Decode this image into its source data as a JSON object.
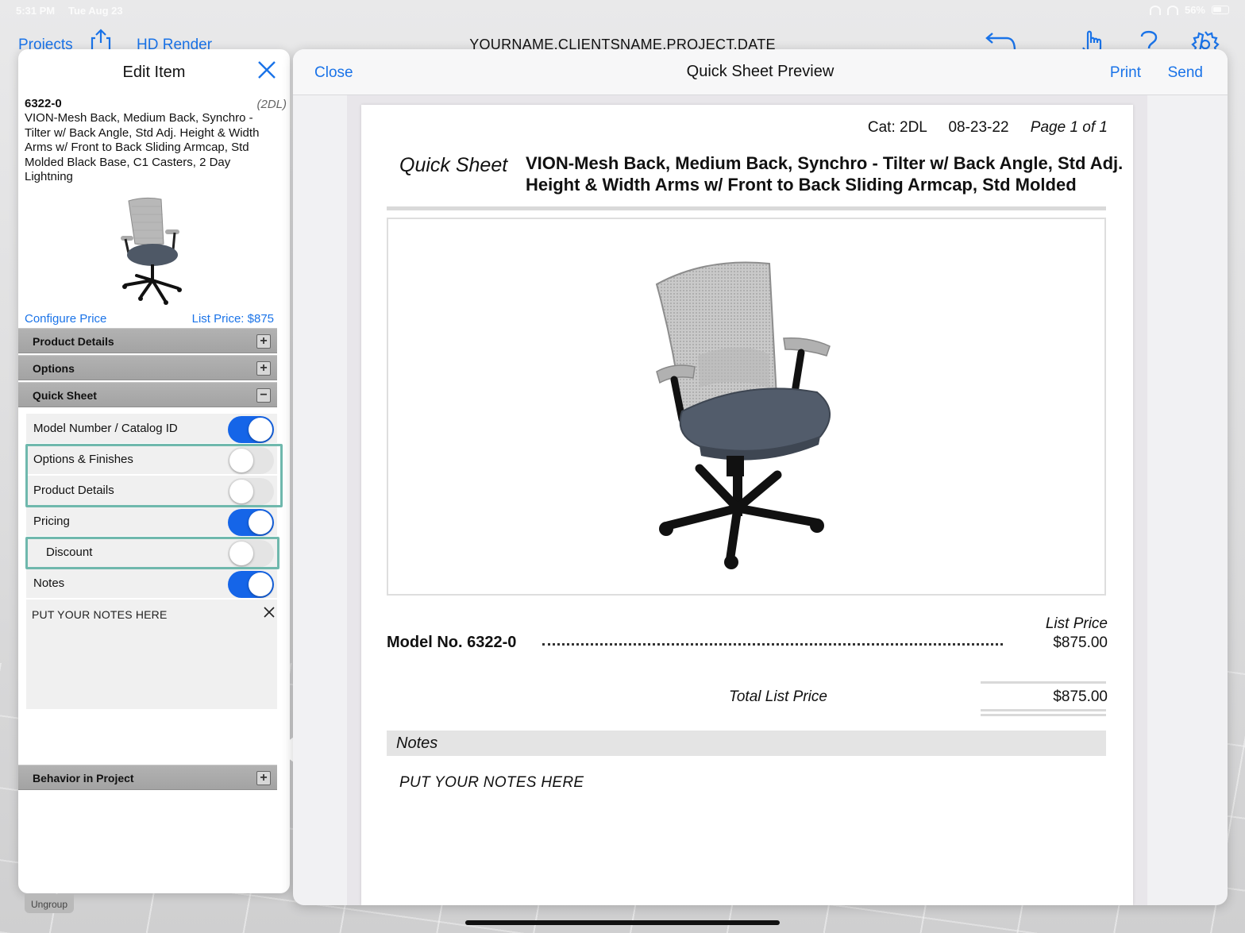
{
  "status_bar": {
    "time": "5:31 PM",
    "date": "Tue Aug 23",
    "battery": "56%"
  },
  "toolbar": {
    "projects_label": "Projects",
    "hd_render_label": "HD Render",
    "project_title": "YOURNAME.CLIENTSNAME.PROJECT.DATE",
    "icons": [
      "share-icon",
      "undo-icon",
      "hand-icon",
      "help-icon",
      "settings-icon"
    ]
  },
  "edit_item": {
    "title": "Edit Item",
    "model_id": "6322-0",
    "cat_code": "(2DL)",
    "description": "VION-Mesh Back, Medium Back, Synchro - Tilter w/ Back Angle, Std Adj. Height & Width Arms w/ Front to Back Sliding Armcap, Std Molded Black Base, C1 Casters, 2 Day Lightning",
    "configure_price_label": "Configure Price",
    "list_price_label": "List Price: $875",
    "sections": {
      "product_details": "Product Details",
      "options": "Options",
      "quick_sheet": "Quick Sheet",
      "behavior": "Behavior in Project"
    },
    "quick_sheet_rows": [
      {
        "label": "Model Number / Catalog ID",
        "on": true
      },
      {
        "label": "Options & Finishes",
        "on": false
      },
      {
        "label": "Product Details",
        "on": false
      },
      {
        "label": "Pricing",
        "on": true
      },
      {
        "label": "Discount",
        "on": false
      },
      {
        "label": "Notes",
        "on": true
      }
    ],
    "notes_text": "PUT YOUR NOTES HERE"
  },
  "preview": {
    "close_label": "Close",
    "title": "Quick Sheet Preview",
    "print_label": "Print",
    "send_label": "Send",
    "sheet": {
      "cat": "Cat: 2DL",
      "date": "08-23-22",
      "page": "Page 1 of 1",
      "label": "Quick Sheet",
      "title": "VION-Mesh Back, Medium Back, Synchro - Tilter w/ Back Angle, Std Adj. Height & Width Arms w/ Front to Back Sliding Armcap, Std Molded",
      "list_price_label": "List Price",
      "model_no": "Model No. 6322-0",
      "price": "$875.00",
      "total_label": "Total List Price",
      "total": "$875.00",
      "notes_label": "Notes",
      "notes_body": "PUT YOUR NOTES HERE"
    }
  },
  "bottom": {
    "ungroup_label": "Ungroup"
  },
  "colors": {
    "accent": "#1a73e8",
    "switch_on": "#1565e8",
    "highlight": "#6fb8ad"
  }
}
